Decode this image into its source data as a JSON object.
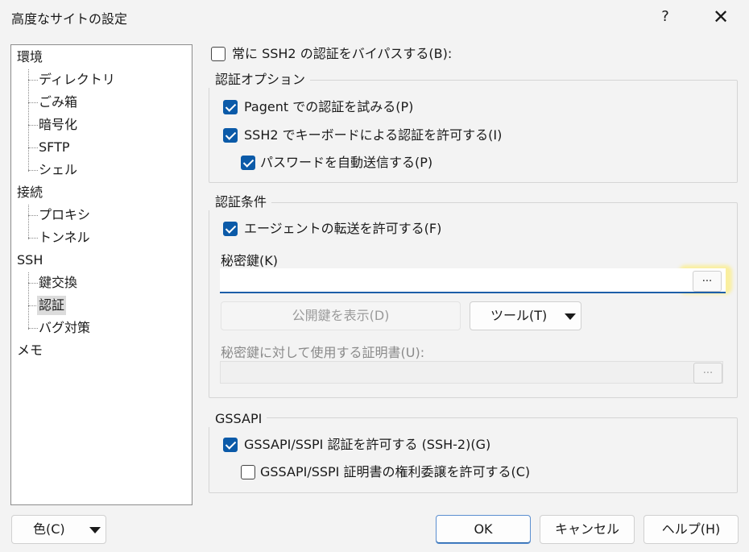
{
  "window": {
    "title": "高度なサイトの設定",
    "help_glyph": "?",
    "close_glyph": "✕"
  },
  "tree": {
    "items": [
      {
        "label": "環境",
        "level": 0
      },
      {
        "label": "ディレクトリ",
        "level": 1
      },
      {
        "label": "ごみ箱",
        "level": 1
      },
      {
        "label": "暗号化",
        "level": 1
      },
      {
        "label": "SFTP",
        "level": 1
      },
      {
        "label": "シェル",
        "level": 1
      },
      {
        "label": "接続",
        "level": 0
      },
      {
        "label": "プロキシ",
        "level": 1
      },
      {
        "label": "トンネル",
        "level": 1
      },
      {
        "label": "SSH",
        "level": 0
      },
      {
        "label": "鍵交換",
        "level": 1
      },
      {
        "label": "認証",
        "level": 1,
        "selected": true
      },
      {
        "label": "バグ対策",
        "level": 1
      },
      {
        "label": "メモ",
        "level": 0
      }
    ]
  },
  "bypass": {
    "label": "常に SSH2 の認証をバイパスする(B):",
    "checked": false
  },
  "auth_options": {
    "title": "認証オプション",
    "pageant": {
      "label": "Pagent での認証を試みる(P)",
      "checked": true
    },
    "keyboard": {
      "label": "SSH2 でキーボードによる認証を許可する(I)",
      "checked": true
    },
    "password": {
      "label": "パスワードを自動送信する(P)",
      "checked": true
    }
  },
  "auth_conditions": {
    "title": "認証条件",
    "agent_forward": {
      "label": "エージェントの転送を許可する(F)",
      "checked": true
    },
    "private_key_label": "秘密鍵(K)",
    "private_key_value": "",
    "browse_label": "...",
    "show_public_key_label": "公開鍵を表示(D)",
    "tools_label": "ツール(T)",
    "cert_label": "秘密鍵に対して使用する証明書(U):",
    "cert_value": "",
    "cert_browse_label": "..."
  },
  "gssapi": {
    "title": "GSSAPI",
    "allow": {
      "label": "GSSAPI/SSPI 認証を許可する (SSH-2)(G)",
      "checked": true
    },
    "delegate": {
      "label": "GSSAPI/SSPI 証明書の権利委譲を許可する(C)",
      "checked": false
    }
  },
  "footer": {
    "color_label": "色(C)",
    "ok_label": "OK",
    "cancel_label": "キャンセル",
    "help_label": "ヘルプ(H)"
  },
  "colors": {
    "accent": "#0b5aa8",
    "highlight": "#ffeb5a"
  }
}
